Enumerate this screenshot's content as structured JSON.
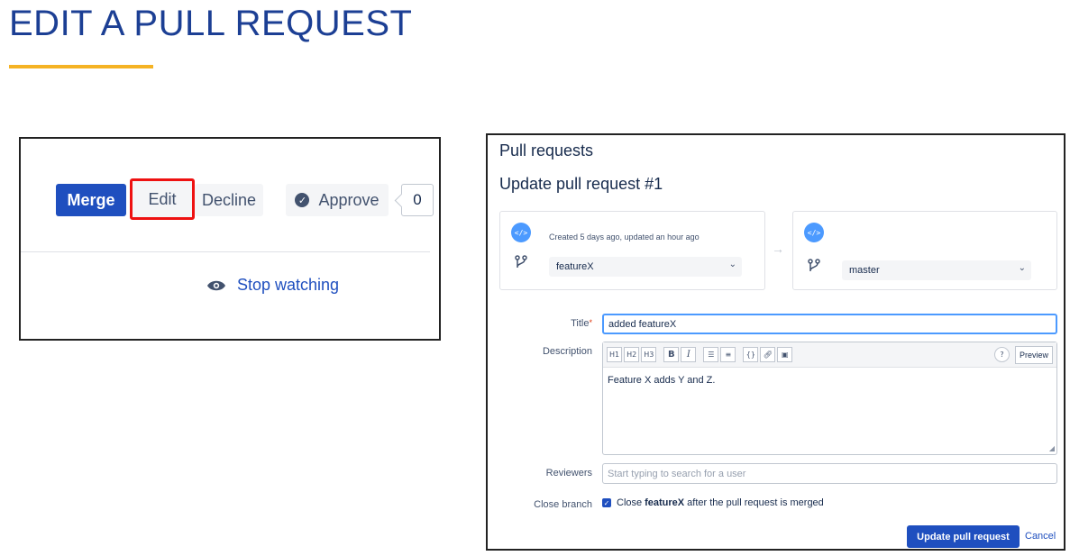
{
  "slide": {
    "title": "EDIT A PULL REQUEST",
    "accent_color": "#f5b324",
    "title_color": "#1c3f94"
  },
  "left_panel": {
    "merge_label": "Merge",
    "edit_label": "Edit",
    "decline_label": "Decline",
    "approve_label": "Approve",
    "approve_count": "0",
    "stop_watching_label": "Stop watching",
    "highlight_color": "#e11111"
  },
  "right_panel": {
    "heading": "Pull requests",
    "subheading": "Update pull request #1",
    "source": {
      "created_text": "Created 5 days ago, updated an hour ago",
      "branch": "featureX"
    },
    "destination": {
      "branch": "master"
    },
    "form": {
      "title_label": "Title",
      "title_required_mark": "*",
      "title_value": "added featureX",
      "description_label": "Description",
      "description_value": "Feature X adds Y and Z.",
      "toolbar": {
        "h1": "H1",
        "h2": "H2",
        "h3": "H3",
        "bold": "B",
        "italic": "I",
        "preview": "Preview"
      },
      "reviewers_label": "Reviewers",
      "reviewers_placeholder": "Start typing to search for a user",
      "close_branch_label": "Close branch",
      "close_prefix": "Close",
      "close_branch_name": "featureX",
      "close_suffix": "after the pull request is merged",
      "close_checked": true,
      "update_button": "Update pull request",
      "cancel_button": "Cancel"
    },
    "primary_color": "#1f4fbf"
  }
}
